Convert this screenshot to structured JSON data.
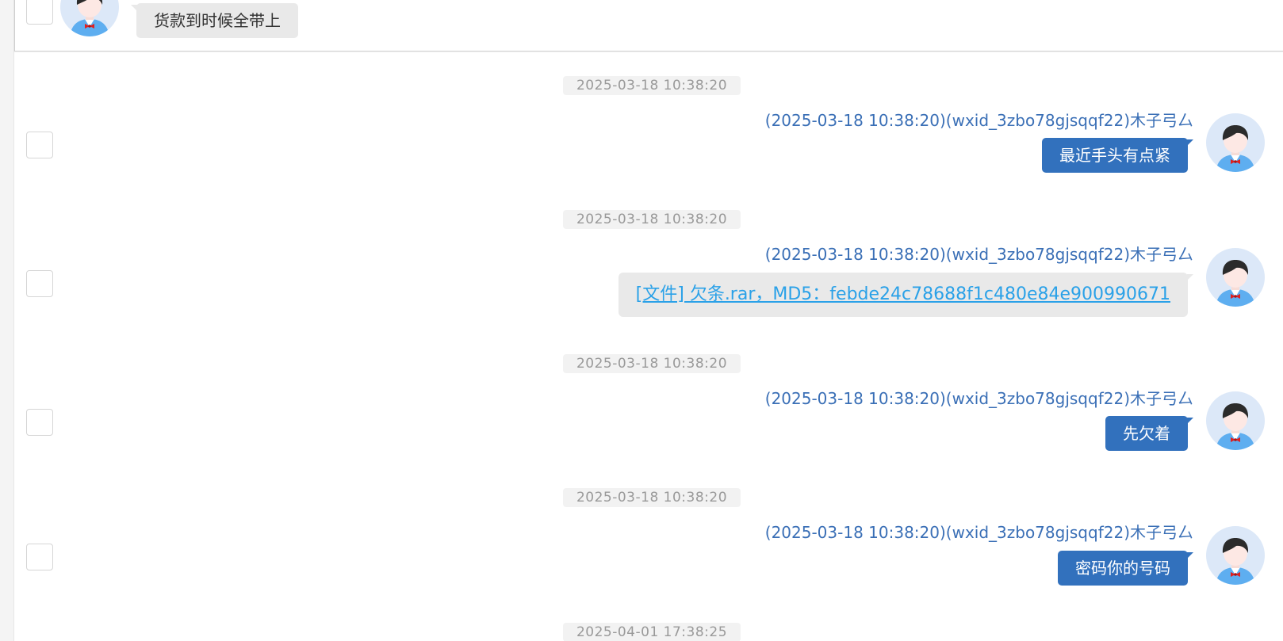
{
  "colors": {
    "sent_bubble": "#3271bd",
    "received_bubble": "#e9e9e9",
    "sender_text": "#3a6fb6",
    "file_link": "#2aa1e8",
    "timestamp_text": "#999999"
  },
  "top_message": {
    "text": "货款到时候全带上",
    "avatar_icon": "user-avatar-icon"
  },
  "messages": [
    {
      "timestamp": "2025-03-18 10:38:20",
      "sender": "(2025-03-18 10:38:20)(wxid_3zbo78gjsqqf22)木子弓厶",
      "text": "最近手头有点紧",
      "type": "text"
    },
    {
      "timestamp": "2025-03-18 10:38:20",
      "sender": "(2025-03-18 10:38:20)(wxid_3zbo78gjsqqf22)木子弓厶",
      "text": "[文件] 欠条.rar，MD5：febde24c78688f1c480e84e900990671",
      "type": "file"
    },
    {
      "timestamp": "2025-03-18 10:38:20",
      "sender": "(2025-03-18 10:38:20)(wxid_3zbo78gjsqqf22)木子弓厶",
      "text": "先欠着",
      "type": "text"
    },
    {
      "timestamp": "2025-03-18 10:38:20",
      "sender": "(2025-03-18 10:38:20)(wxid_3zbo78gjsqqf22)木子弓厶",
      "text": "密码你的号码",
      "type": "text"
    }
  ],
  "last_timestamp": "2025-04-01 17:38:25"
}
